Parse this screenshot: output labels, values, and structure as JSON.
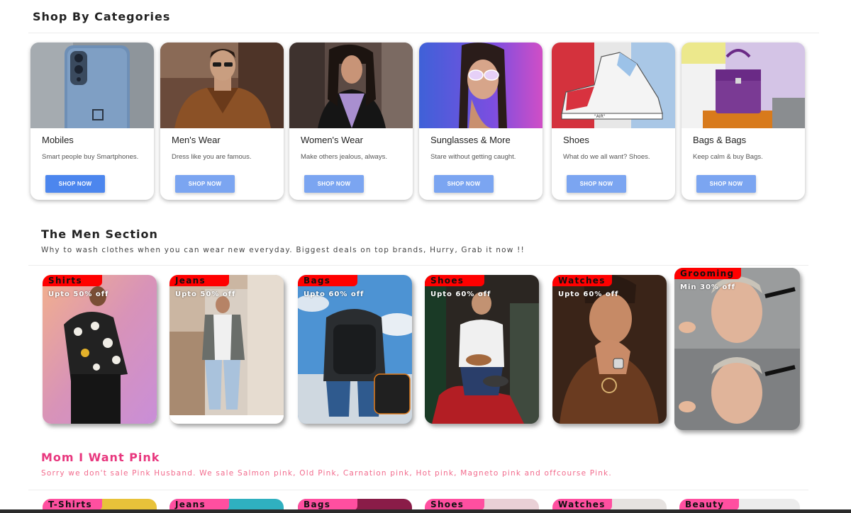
{
  "shop_section": {
    "title": "Shop By Categories",
    "categories": [
      {
        "name": "Mobiles",
        "desc": "Smart people buy Smartphones.",
        "button": "SHOP NOW",
        "image_icon": "phone-image"
      },
      {
        "name": "Men's Wear",
        "desc": "Dress like you are famous.",
        "button": "SHOP NOW",
        "image_icon": "man-image"
      },
      {
        "name": "Women's Wear",
        "desc": "Make others jealous, always.",
        "button": "SHOP NOW",
        "image_icon": "woman-image"
      },
      {
        "name": "Sunglasses & More",
        "desc": "Stare without getting caught.",
        "button": "SHOP NOW",
        "image_icon": "sunglasses-image"
      },
      {
        "name": "Shoes",
        "desc": "What do we all want? Shoes.",
        "button": "SHOP NOW",
        "image_icon": "sneaker-image"
      },
      {
        "name": "Bags & Bags",
        "desc": "Keep calm & buy Bags.",
        "button": "SHOP NOW",
        "image_icon": "handbag-image"
      }
    ]
  },
  "men_section": {
    "title": "The Men Section",
    "subtitle": "Why to wash clothes when you can wear new everyday. Biggest deals on top brands, Hurry, Grab it now !!",
    "tiles": [
      {
        "tag": "Shirts",
        "offer": "Upto 50% off"
      },
      {
        "tag": "Jeans",
        "offer": "Upto 50% off"
      },
      {
        "tag": "Bags",
        "offer": "Upto 60% off"
      },
      {
        "tag": "Shoes",
        "offer": "Upto 60% off"
      },
      {
        "tag": "Watches",
        "offer": "Upto 60% off"
      },
      {
        "tag": "Grooming",
        "offer": "Min 30% off"
      }
    ]
  },
  "pink_section": {
    "title": "Mom I Want Pink",
    "subtitle": "Sorry we don't sale Pink Husband. We sale Salmon pink, Old Pink, Carnation pink, Hot pink, Magneto pink and offcourse Pink.",
    "tiles": [
      {
        "tag": "T-Shirts"
      },
      {
        "tag": "Jeans"
      },
      {
        "tag": "Bags"
      },
      {
        "tag": "Shoes"
      },
      {
        "tag": "Watches"
      },
      {
        "tag": "Beauty"
      }
    ]
  },
  "colors": {
    "button_primary": "#4c86ee",
    "button": "#7ba5f1",
    "men_tag": "#ff0000",
    "pink_title": "#e8377e",
    "pink_tag": "#ff4fa0"
  }
}
